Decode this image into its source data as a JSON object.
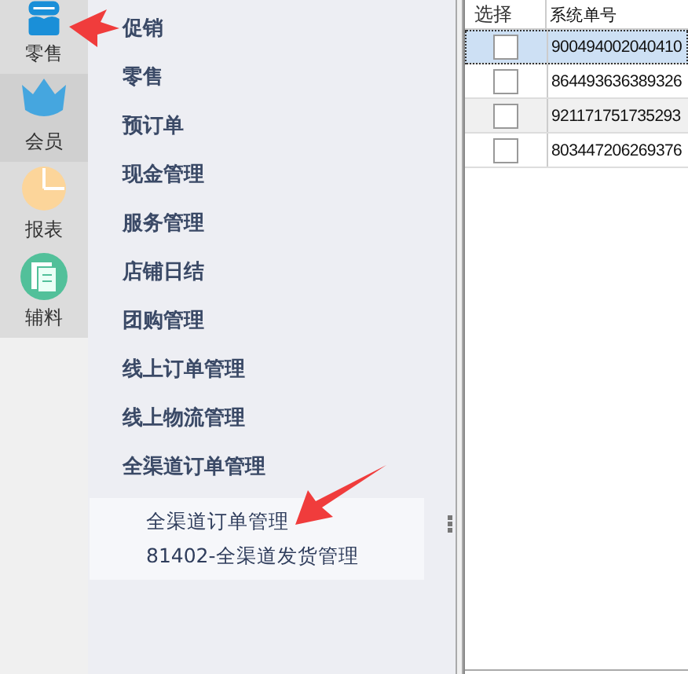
{
  "nav_rail": [
    {
      "kind": "store",
      "label": "零售",
      "selected": false
    },
    {
      "kind": "crown",
      "label": "会员",
      "selected": true
    },
    {
      "kind": "pie",
      "label": "报表",
      "selected": false
    },
    {
      "kind": "document",
      "label": "辅料",
      "selected": false
    }
  ],
  "menu": {
    "items": [
      {
        "label": "促销"
      },
      {
        "label": "零售"
      },
      {
        "label": "预订单"
      },
      {
        "label": "现金管理"
      },
      {
        "label": "服务管理"
      },
      {
        "label": "店铺日结"
      },
      {
        "label": "团购管理"
      },
      {
        "label": "线上订单管理"
      },
      {
        "label": "线上物流管理"
      },
      {
        "label": "全渠道订单管理",
        "children": [
          {
            "label": "全渠道订单管理"
          },
          {
            "label": "81402-全渠道发货管理"
          }
        ]
      }
    ]
  },
  "table": {
    "columns": [
      "选择",
      "系统单号"
    ],
    "rows": [
      {
        "selected": true,
        "checked": false,
        "order_no": "900494002040410"
      },
      {
        "selected": false,
        "checked": false,
        "order_no": "864493636389326"
      },
      {
        "selected": false,
        "checked": false,
        "order_no": "921171751735293"
      },
      {
        "selected": false,
        "checked": false,
        "order_no": "803447206269376"
      }
    ]
  }
}
